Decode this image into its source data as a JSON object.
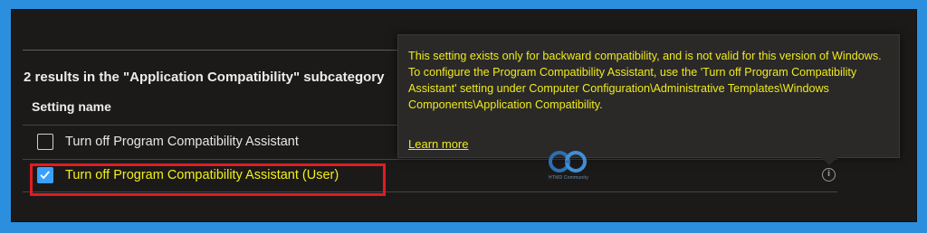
{
  "results": {
    "summary": "2 results in the \"Application Compatibility\" subcategory"
  },
  "table": {
    "column_header": "Setting name",
    "rows": [
      {
        "label": "Turn off Program Compatibility Assistant",
        "checked": false
      },
      {
        "label": "Turn off Program Compatibility Assistant (User)",
        "checked": true
      }
    ]
  },
  "tooltip": {
    "text": "This setting exists only for backward compatibility, and is not valid for this version of Windows. To configure the Program Compatibility Assistant, use the 'Turn off Program Compatibility Assistant' setting under Computer Configuration\\Administrative Templates\\Windows Components\\Application Compatibility.",
    "link_label": "Learn more"
  },
  "info_icon_glyph": "i",
  "watermark": {
    "text": "HTMD Community",
    "icon": "htmd-logo-icon"
  },
  "colors": {
    "frame": "#2b8fde",
    "background": "#1b1a19",
    "highlight_text": "#f0ea1c",
    "annotation_border": "#e11c22",
    "checkbox_checked": "#3aa0ff"
  }
}
